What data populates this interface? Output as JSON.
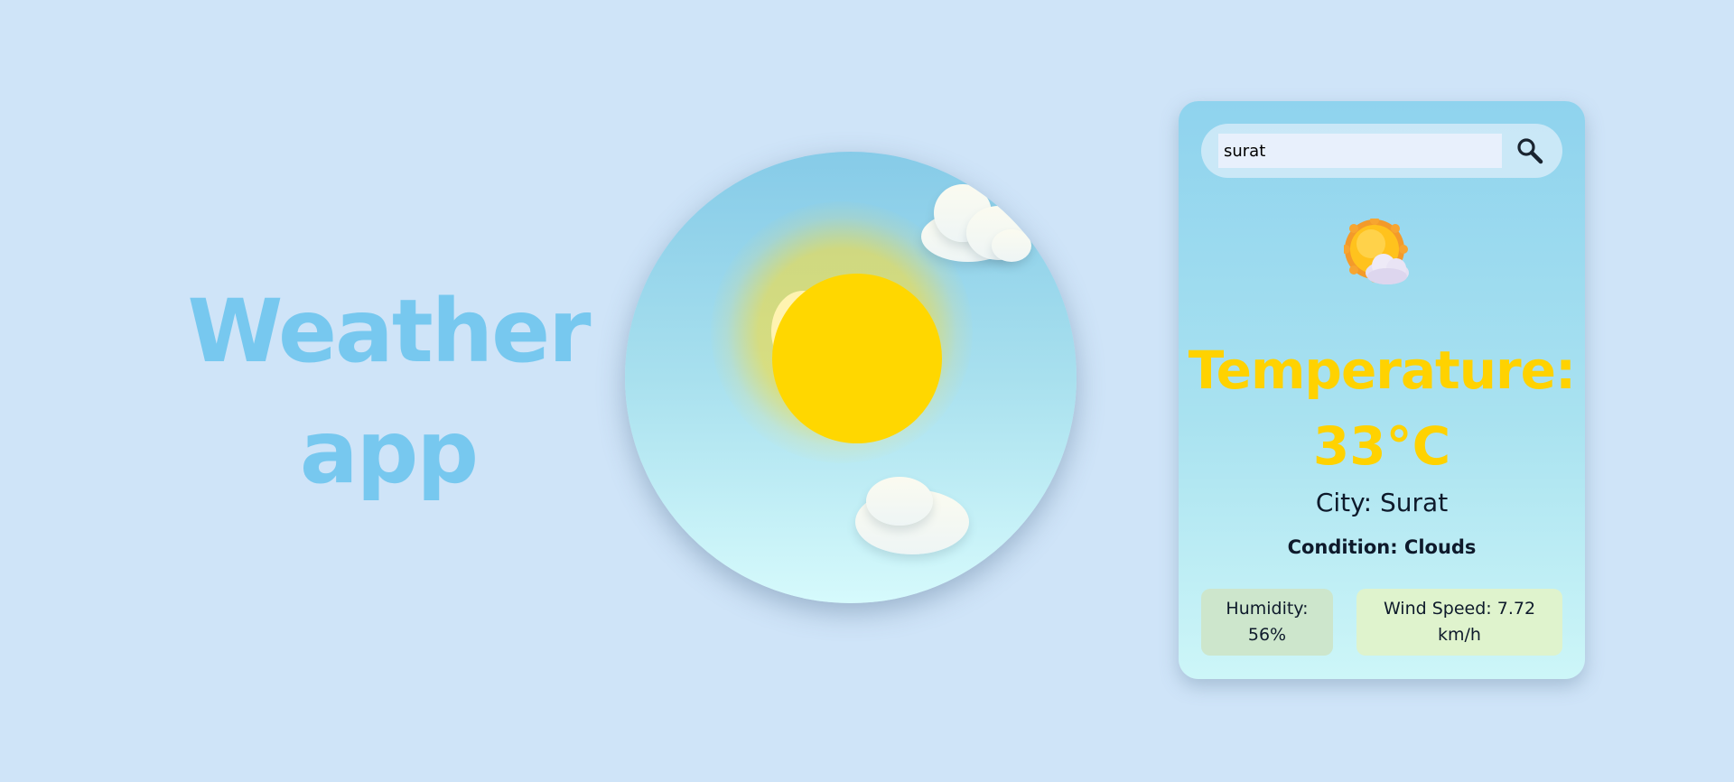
{
  "hero": {
    "title_line1": "Weather",
    "title_line2": "app"
  },
  "search": {
    "value": "surat",
    "icon": "search-icon"
  },
  "weather": {
    "icon": "sun-behind-cloud-icon",
    "temperature_label": "Temperature:",
    "temperature_value": "33°C",
    "city": "City: Surat",
    "condition": "Condition: Clouds",
    "humidity": "Humidity: 56%",
    "wind_speed": "Wind Speed: 7.72 km/h"
  },
  "colors": {
    "background": "#cfe4f8",
    "title": "#77c8ef",
    "accent_yellow": "#ffd200",
    "humidity_box": "#cde6cc",
    "wind_box": "#dff3cd"
  }
}
